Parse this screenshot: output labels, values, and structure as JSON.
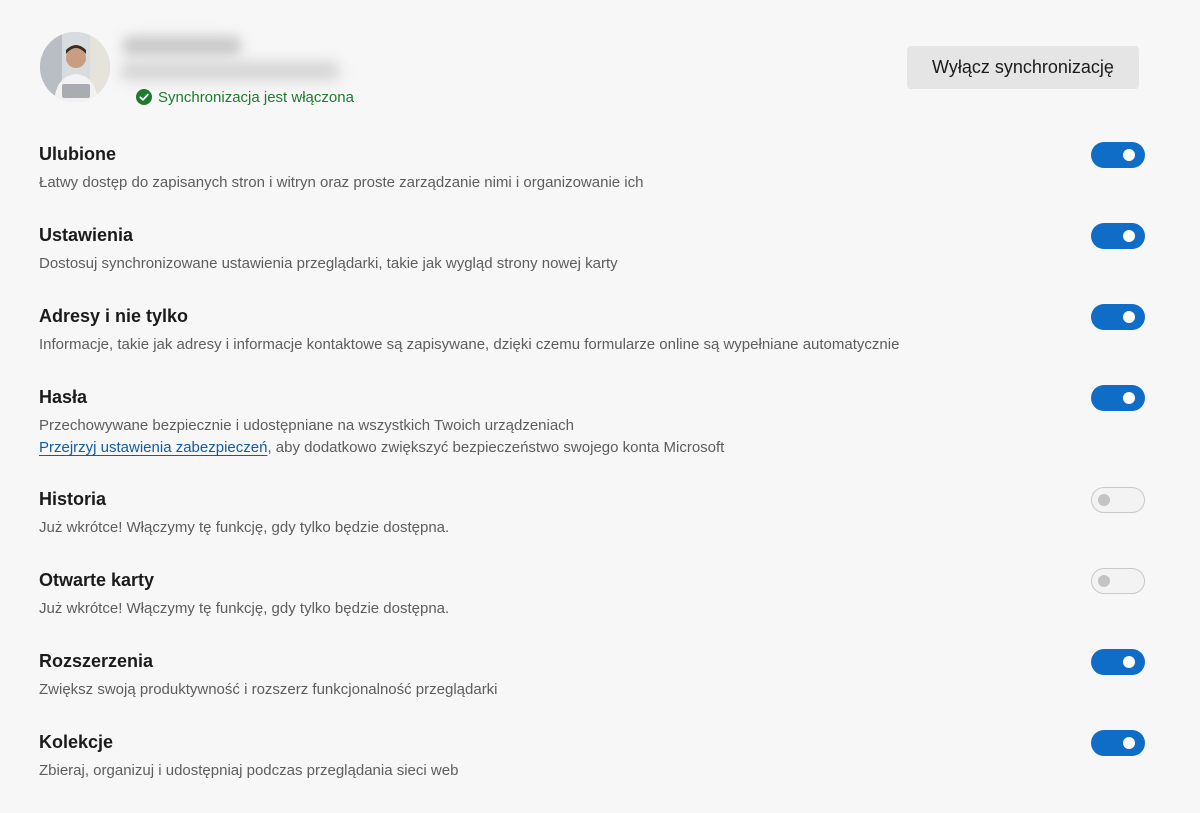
{
  "profile": {
    "status": "Synchronizacja jest włączona",
    "turn_off_label": "Wyłącz synchronizację"
  },
  "items": [
    {
      "title": "Ulubione",
      "desc": "Łatwy dostęp do zapisanych stron i witryn oraz proste zarządzanie nimi i organizowanie ich",
      "enabled": true
    },
    {
      "title": "Ustawienia",
      "desc": "Dostosuj synchronizowane ustawienia przeglądarki, takie jak wygląd strony nowej karty",
      "enabled": true
    },
    {
      "title": "Adresy i nie tylko",
      "desc": "Informacje, takie jak adresy i informacje kontaktowe są zapisywane, dzięki czemu formularze online są wypełniane automatycznie",
      "enabled": true
    },
    {
      "title": "Hasła",
      "desc": "Przechowywane bezpiecznie i udostępniane na wszystkich Twoich urządzeniach",
      "link": "Przejrzyj ustawienia zabezpieczeń",
      "link_suffix": ", aby dodatkowo zwiększyć bezpieczeństwo swojego konta Microsoft",
      "enabled": true
    },
    {
      "title": "Historia",
      "desc": "Już wkrótce! Włączymy tę funkcję, gdy tylko będzie dostępna.",
      "enabled": false
    },
    {
      "title": "Otwarte karty",
      "desc": "Już wkrótce! Włączymy tę funkcję, gdy tylko będzie dostępna.",
      "enabled": false
    },
    {
      "title": "Rozszerzenia",
      "desc": "Zwiększ swoją produktywność i rozszerz funkcjonalność przeglądarki",
      "enabled": true
    },
    {
      "title": "Kolekcje",
      "desc": "Zbieraj, organizuj i udostępniaj podczas przeglądania sieci web",
      "enabled": true
    }
  ],
  "colors": {
    "toggle_on": "#0f6cc7",
    "status_green": "#1e7a2f",
    "link": "#0f5ca8"
  }
}
